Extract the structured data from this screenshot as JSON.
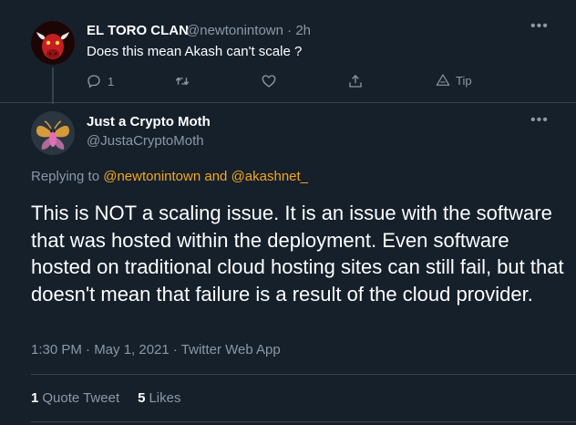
{
  "parent_tweet": {
    "display_name": "EL TORO CLAN",
    "handle": "@newtonintown",
    "time": "2h",
    "text": "Does this mean Akash can't scale ?",
    "reply_count": "1",
    "tip_label": "Tip",
    "avatar_icon": "bull-avatar"
  },
  "main_tweet": {
    "display_name": "Just a Crypto Moth",
    "handle": "@JustaCryptoMoth",
    "replying_prefix": "Replying to",
    "replying_mention_1": "@newtonintown",
    "replying_conj": "and",
    "replying_mention_2": "@akashnet_",
    "text": "This is NOT a scaling issue. It is an issue with the software that was hosted within the deployment. Even software hosted on traditional cloud hosting sites can still fail, but that doesn't mean that failure is a result of the cloud provider.",
    "timestamp": "1:30 PM · May 1, 2021 · Twitter Web App",
    "quote_count": "1",
    "quote_label": "Quote Tweet",
    "like_count": "5",
    "like_label": "Likes",
    "avatar_icon": "moth-avatar"
  },
  "colors": {
    "background": "#15202b",
    "text_primary": "#ffffff",
    "text_secondary": "#8b98a5",
    "mention": "#f5a623",
    "border": "#38444d"
  }
}
